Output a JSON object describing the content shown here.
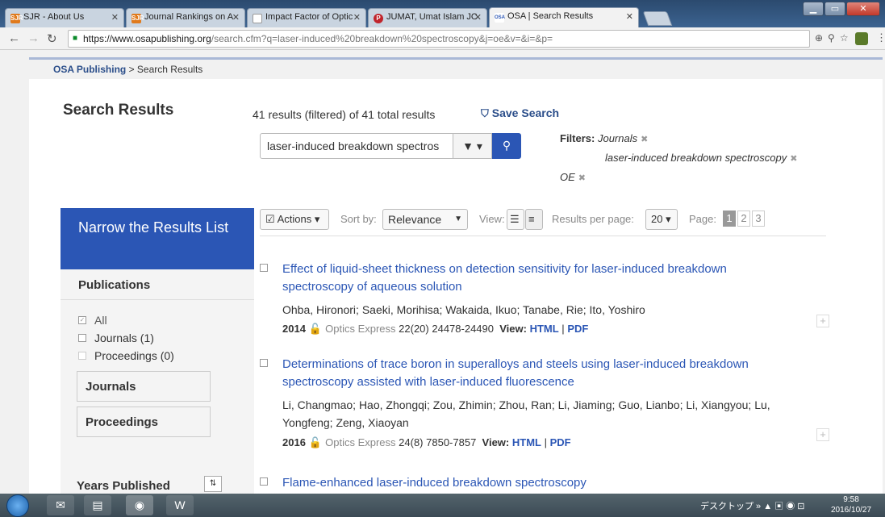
{
  "browser": {
    "tabs": [
      {
        "label": "SJR - About Us",
        "favicon": "SJR"
      },
      {
        "label": "Journal Rankings on A",
        "favicon": "SJR"
      },
      {
        "label": "Impact Factor of Optic",
        "favicon": "doc"
      },
      {
        "label": "JUMAT, Umat Islam JC",
        "favicon": "P"
      },
      {
        "label": "OSA | Search Results",
        "favicon": "OSA"
      }
    ],
    "url_host": "https://www.osapublishing.org",
    "url_path": "/search.cfm?q=laser-induced%20breakdown%20spectroscopy&j=oe&v=&i=&p="
  },
  "breadcrumb": {
    "home": "OSA Publishing",
    "sep": " > ",
    "current": "Search Results"
  },
  "header": {
    "title": "Search Results",
    "count": "41 results (filtered) of 41 total results",
    "save_search": "Save Search"
  },
  "search": {
    "value": "laser-induced breakdown spectros"
  },
  "filters": {
    "label": "Filters:",
    "items": [
      "Journals",
      "laser-induced breakdown spectroscopy",
      "OE"
    ],
    "remove_glyph": "✖"
  },
  "sidebar": {
    "narrow_title": "Narrow the Results List",
    "publications_heading": "Publications",
    "options": [
      {
        "label": "All",
        "checked": true
      },
      {
        "label": "Journals (1)",
        "checked": false
      },
      {
        "label": "Proceedings (0)",
        "checked": false
      }
    ],
    "journals_button": "Journals",
    "proceedings_button": "Proceedings",
    "years_heading": "Years Published"
  },
  "results_toolbar": {
    "actions": "Actions",
    "sort_by_label": "Sort by:",
    "sort_value": "Relevance",
    "view_label": "View:",
    "per_page_label": "Results per page:",
    "per_page_value": "20",
    "page_label": "Page:",
    "pages": [
      "1",
      "2",
      "3"
    ],
    "current_page": "1"
  },
  "results": [
    {
      "title": "Effect of liquid-sheet thickness on detection sensitivity for laser-induced breakdown spectroscopy of aqueous solution",
      "authors": "Ohba, Hironori; Saeki, Morihisa; Wakaida, Ikuo; Tanabe, Rie; Ito, Yoshiro",
      "year": "2014",
      "journal": "Optics Express",
      "volume": "22",
      "issue_pages": "(20) 24478-24490",
      "view_label": "View:",
      "html_link": "HTML",
      "pdf_link": "PDF"
    },
    {
      "title": "Determinations of trace boron in superalloys and steels using laser-induced breakdown spectroscopy assisted with laser-induced fluorescence",
      "authors": "Li, Changmao; Hao, Zhongqi; Zou, Zhimin; Zhou, Ran; Li, Jiaming; Guo, Lianbo; Li, Xiangyou; Lu, Yongfeng; Zeng, Xiaoyan",
      "year": "2016",
      "journal": "Optics Express",
      "volume": "24",
      "issue_pages": "(8) 7850-7857",
      "view_label": "View:",
      "html_link": "HTML",
      "pdf_link": "PDF"
    },
    {
      "title": "Flame-enhanced laser-induced breakdown spectroscopy"
    }
  ],
  "taskbar": {
    "tray_text": "デスクトップ",
    "time": "9:58",
    "date": "2016/10/27"
  }
}
